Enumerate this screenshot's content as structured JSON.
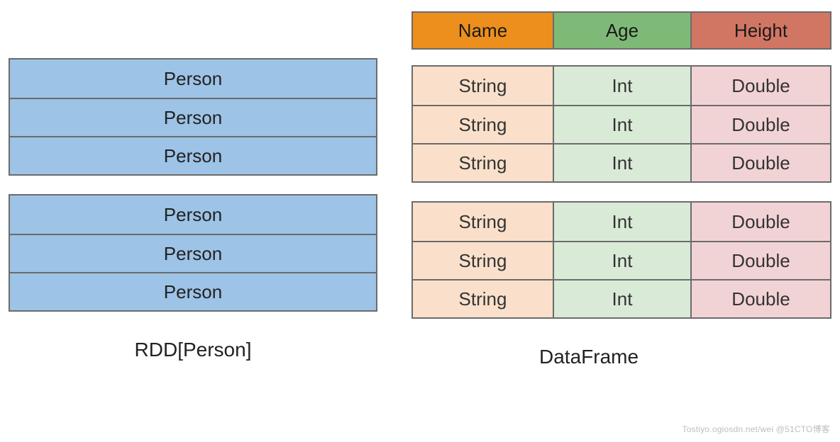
{
  "rdd": {
    "row_label": "Person",
    "caption": "RDD[Person]",
    "blocks": [
      3,
      3
    ]
  },
  "dataframe": {
    "headers": {
      "name": "Name",
      "age": "Age",
      "height": "Height"
    },
    "types": {
      "name": "String",
      "age": "Int",
      "height": "Double"
    },
    "caption": "DataFrame",
    "blocks": [
      3,
      3
    ]
  },
  "watermark": "Tostiyo.ogiosdn.net/wei @51CTO博客"
}
